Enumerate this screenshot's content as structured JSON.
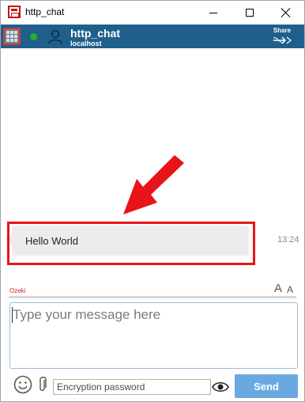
{
  "window": {
    "title": "http_chat"
  },
  "header": {
    "contact_name": "http_chat",
    "contact_host": "localhost",
    "share_label": "Share",
    "status": "online"
  },
  "messages": [
    {
      "text": "Hello World",
      "time": "13:24",
      "direction": "incoming"
    }
  ],
  "compose": {
    "sender_label": "Ozeki",
    "font_increase": "A",
    "font_decrease": "A",
    "placeholder": "Type your message here",
    "encryption_placeholder": "Encryption password",
    "send_label": "Send"
  },
  "colors": {
    "header_bg": "#1f5f8c",
    "online": "#23b02a",
    "highlight": "#e8141a",
    "send_button": "#6aa9e0"
  },
  "icons": [
    "app-icon",
    "minimize-icon",
    "maximize-icon",
    "close-icon",
    "grid-menu-icon",
    "user-icon",
    "share-icon",
    "arrow-annotation",
    "smiley-icon",
    "paperclip-icon",
    "eye-icon"
  ]
}
